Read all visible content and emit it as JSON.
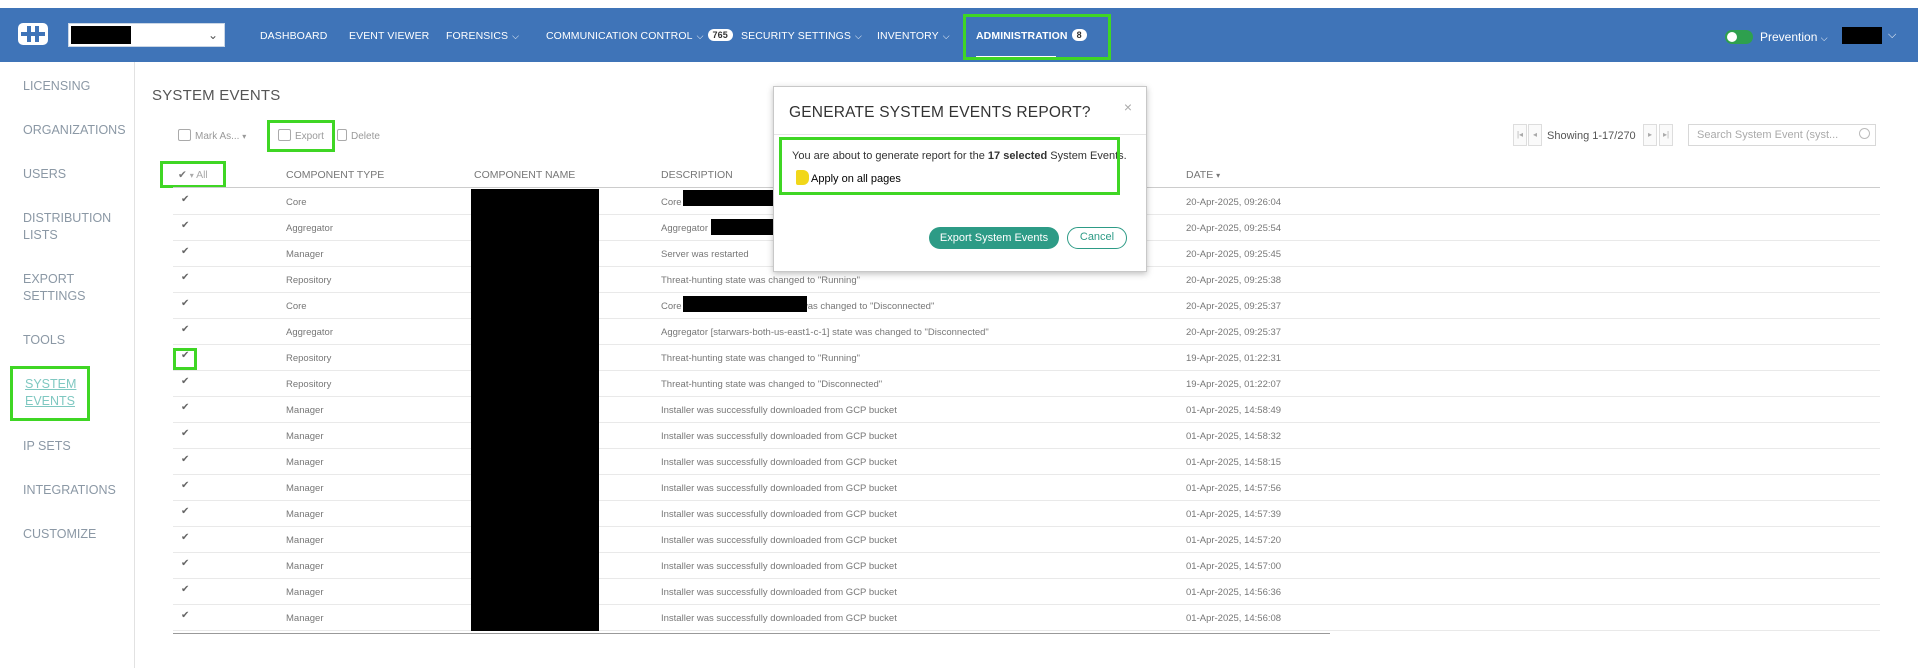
{
  "nav": {
    "items": [
      {
        "label": "DASHBOARD"
      },
      {
        "label": "EVENT VIEWER"
      },
      {
        "label": "FORENSICS"
      },
      {
        "label": "COMMUNICATION CONTROL",
        "badge": "765"
      },
      {
        "label": "SECURITY SETTINGS"
      },
      {
        "label": "INVENTORY"
      },
      {
        "label": "ADMINISTRATION",
        "badge": "8"
      }
    ],
    "mode": "Prevention",
    "accent_color": "#3f74b8",
    "highlight_color": "#3fd624"
  },
  "sidebar": {
    "items": [
      {
        "label": "LICENSING"
      },
      {
        "label": "ORGANIZATIONS"
      },
      {
        "label": "USERS"
      },
      {
        "label": "DISTRIBUTION LISTS"
      },
      {
        "label": "EXPORT SETTINGS"
      },
      {
        "label": "TOOLS"
      },
      {
        "label": "SYSTEM EVENTS"
      },
      {
        "label": "IP SETS"
      },
      {
        "label": "INTEGRATIONS"
      },
      {
        "label": "CUSTOMIZE"
      }
    ]
  },
  "page": {
    "title": "SYSTEM EVENTS"
  },
  "toolbar": {
    "mark_as": "Mark As...",
    "export": "Export",
    "delete": "Delete",
    "showing": "Showing 1-17/270",
    "search_placeholder": "Search System Event (syst..."
  },
  "table": {
    "select_all": "All",
    "headers": [
      "COMPONENT TYPE",
      "COMPONENT NAME",
      "DESCRIPTION",
      "DATE"
    ],
    "rows": [
      {
        "type": "Core",
        "desc": "Core",
        "date": "20-Apr-2025, 09:26:04"
      },
      {
        "type": "Aggregator",
        "desc": "Aggregator",
        "date": "20-Apr-2025, 09:25:54"
      },
      {
        "type": "Manager",
        "desc": "Server was restarted",
        "date": "20-Apr-2025, 09:25:45"
      },
      {
        "type": "Repository",
        "desc": "Threat-hunting state was changed to \"Running\"",
        "date": "20-Apr-2025, 09:25:38"
      },
      {
        "type": "Core",
        "desc": "Core",
        "desc_tail": "state was changed to \"Disconnected\"",
        "date": "20-Apr-2025, 09:25:37"
      },
      {
        "type": "Aggregator",
        "desc": "Aggregator [starwars-both-us-east1-c-1] state was changed to \"Disconnected\"",
        "date": "20-Apr-2025, 09:25:37"
      },
      {
        "type": "Repository",
        "desc": "Threat-hunting state was changed to \"Running\"",
        "date": "19-Apr-2025, 01:22:31"
      },
      {
        "type": "Repository",
        "desc": "Threat-hunting state was changed to \"Disconnected\"",
        "date": "19-Apr-2025, 01:22:07"
      },
      {
        "type": "Manager",
        "desc": "Installer was successfully downloaded from GCP bucket",
        "date": "01-Apr-2025, 14:58:49"
      },
      {
        "type": "Manager",
        "desc": "Installer was successfully downloaded from GCP bucket",
        "date": "01-Apr-2025, 14:58:32"
      },
      {
        "type": "Manager",
        "desc": "Installer was successfully downloaded from GCP bucket",
        "date": "01-Apr-2025, 14:58:15"
      },
      {
        "type": "Manager",
        "desc": "Installer was successfully downloaded from GCP bucket",
        "date": "01-Apr-2025, 14:57:56"
      },
      {
        "type": "Manager",
        "desc": "Installer was successfully downloaded from GCP bucket",
        "date": "01-Apr-2025, 14:57:39"
      },
      {
        "type": "Manager",
        "desc": "Installer was successfully downloaded from GCP bucket",
        "date": "01-Apr-2025, 14:57:20"
      },
      {
        "type": "Manager",
        "desc": "Installer was successfully downloaded from GCP bucket",
        "date": "01-Apr-2025, 14:57:00"
      },
      {
        "type": "Manager",
        "desc": "Installer was successfully downloaded from GCP bucket",
        "date": "01-Apr-2025, 14:56:36"
      },
      {
        "type": "Manager",
        "desc": "Installer was successfully downloaded from GCP bucket",
        "date": "01-Apr-2025, 14:56:08"
      }
    ]
  },
  "modal": {
    "title": "GENERATE SYSTEM EVENTS REPORT?",
    "close": "×",
    "text_prefix": "You are about to generate report for the",
    "text_count": "17 selected",
    "text_suffix": "System Events.",
    "apply_all": "Apply on all pages",
    "export_button": "Export System Events",
    "cancel_button": "Cancel"
  }
}
